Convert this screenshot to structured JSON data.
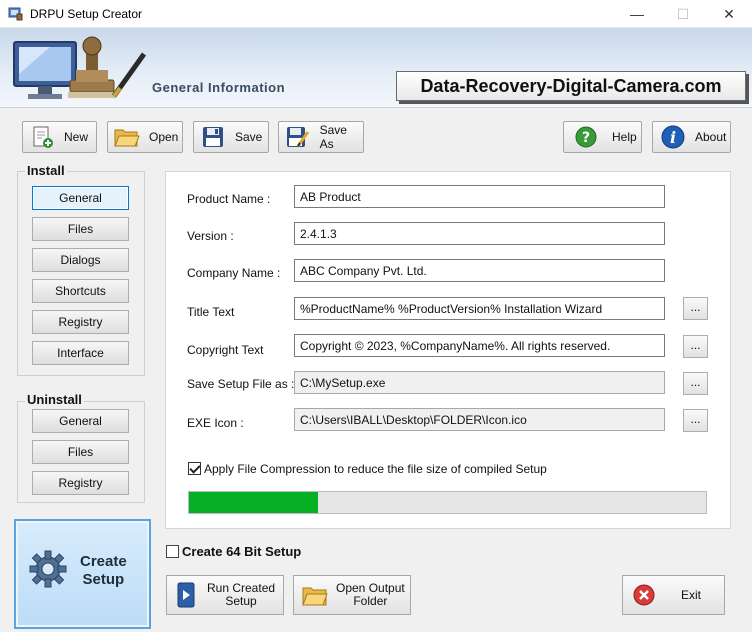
{
  "window": {
    "title": "DRPU Setup Creator",
    "minimize_glyph": "—",
    "maximize_glyph": "☐",
    "close_glyph": "✕"
  },
  "banner": {
    "section_title": "General Information",
    "website": "Data-Recovery-Digital-Camera.com"
  },
  "toolbar": {
    "new_label": "New",
    "open_label": "Open",
    "save_label": "Save",
    "save_as_label": "Save As",
    "help_label": "Help",
    "about_label": "About"
  },
  "install": {
    "title": "Install",
    "items": [
      {
        "label": "General",
        "active": true
      },
      {
        "label": "Files"
      },
      {
        "label": "Dialogs"
      },
      {
        "label": "Shortcuts"
      },
      {
        "label": "Registry"
      },
      {
        "label": "Interface"
      }
    ]
  },
  "uninstall": {
    "title": "Uninstall",
    "items": [
      {
        "label": "General"
      },
      {
        "label": "Files"
      },
      {
        "label": "Registry"
      }
    ]
  },
  "form": {
    "product_name": {
      "label": "Product Name :",
      "value": "AB Product"
    },
    "version": {
      "label": "Version :",
      "value": "2.4.1.3"
    },
    "company_name": {
      "label": "Company Name :",
      "value": "ABC Company Pvt. Ltd."
    },
    "title_text": {
      "label": "Title Text",
      "value": "%ProductName% %ProductVersion% Installation Wizard"
    },
    "copyright_text": {
      "label": "Copyright Text",
      "value": "Copyright © 2023, %CompanyName%. All rights reserved."
    },
    "save_setup_file": {
      "label": "Save Setup File as :",
      "value": "C:\\MySetup.exe"
    },
    "exe_icon": {
      "label": "EXE Icon :",
      "value": "C:\\Users\\IBALL\\Desktop\\FOLDER\\Icon.ico"
    },
    "browse_label": "...",
    "compression": {
      "label": "Apply File Compression to reduce the file size of compiled Setup",
      "checked": true
    },
    "progress_fraction": 0.25
  },
  "bottom": {
    "create_setup_label_1": "Create",
    "create_setup_label_2": "Setup",
    "create_64bit_label": "Create 64 Bit Setup",
    "run_created_1": "Run Created",
    "run_created_2": "Setup",
    "open_output_1": "Open Output",
    "open_output_2": "Folder",
    "exit_label": "Exit"
  },
  "colors": {
    "progress_fill": "#06b025",
    "active_border": "#0078d7",
    "exit_red": "#d93a3a",
    "help_green": "#3a9a3a",
    "about_blue": "#1f5fb5"
  }
}
